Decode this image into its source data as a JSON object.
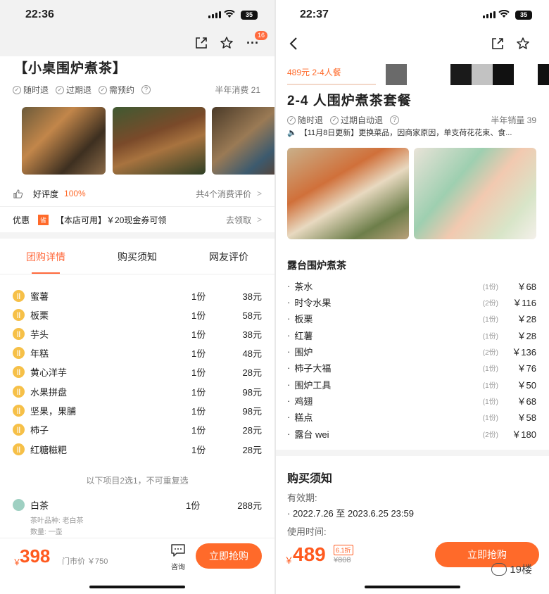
{
  "left": {
    "status": {
      "time": "22:36",
      "battery": "35"
    },
    "nav": {
      "badge": "16"
    },
    "shop_title": "【小桌围炉煮茶】",
    "tags": [
      "随时退",
      "过期退",
      "需预约"
    ],
    "half_year_consume": "半年消费 21",
    "rating": {
      "label": "好评度",
      "value": "100%",
      "reviews": "共4个消费评价"
    },
    "coupon": {
      "label": "优惠",
      "tag": "省",
      "text": "【本店可用】￥20现金券可领",
      "action": "去领取"
    },
    "tabs": [
      "团购详情",
      "购买须知",
      "网友评价"
    ],
    "items": [
      {
        "name": "蜜薯",
        "qty": "1份",
        "price": "38元"
      },
      {
        "name": "板栗",
        "qty": "1份",
        "price": "58元"
      },
      {
        "name": "芋头",
        "qty": "1份",
        "price": "38元"
      },
      {
        "name": "年糕",
        "qty": "1份",
        "price": "48元"
      },
      {
        "name": "黄心洋芋",
        "qty": "1份",
        "price": "28元"
      },
      {
        "name": "水果拼盘",
        "qty": "1份",
        "price": "98元"
      },
      {
        "name": "坚果，果脯",
        "qty": "1份",
        "price": "98元"
      },
      {
        "name": "柿子",
        "qty": "1份",
        "price": "28元"
      },
      {
        "name": "红糖糍粑",
        "qty": "1份",
        "price": "28元"
      }
    ],
    "choice_note": "以下项目2选1，不可重复选",
    "tea": {
      "name": "白茶",
      "qty": "1份",
      "price": "288元",
      "variety": "茶叶品种: 老白茶",
      "amount": "数量: 一壶"
    },
    "bottom": {
      "currency": "￥",
      "price": "398",
      "original": "门市价 ￥750",
      "consult": "咨询",
      "buy": "立即抢购"
    }
  },
  "right": {
    "status": {
      "time": "22:37",
      "battery": "35"
    },
    "package_tag": "489元 2-4人餐",
    "title": "2-4 人围炉煮茶套餐",
    "tags": [
      "随时退",
      "过期自动退"
    ],
    "half_year_sales": "半年销量 39",
    "notice": "【11月8日更新】更换菜品，因商家原因，单支荷花花束、食...",
    "section": "露台围炉煮茶",
    "items": [
      {
        "name": "茶水",
        "qty": "(1份)",
        "price": "￥68"
      },
      {
        "name": "时令水果",
        "qty": "(2份)",
        "price": "￥116"
      },
      {
        "name": "板栗",
        "qty": "(1份)",
        "price": "￥28"
      },
      {
        "name": "红薯",
        "qty": "(1份)",
        "price": "￥28"
      },
      {
        "name": "围炉",
        "qty": "(2份)",
        "price": "￥136"
      },
      {
        "name": "柿子大福",
        "qty": "(1份)",
        "price": "￥76"
      },
      {
        "name": "围炉工具",
        "qty": "(1份)",
        "price": "￥50"
      },
      {
        "name": "鸡翅",
        "qty": "(1份)",
        "price": "￥68"
      },
      {
        "name": "糕点",
        "qty": "(1份)",
        "price": "￥58"
      },
      {
        "name": "露台 wei",
        "qty": "(2份)",
        "price": "￥180"
      }
    ],
    "purchase_notes": {
      "title": "购买须知",
      "validity_label": "有效期:",
      "validity": "2022.7.26 至 2023.6.25 23:59",
      "usage_label": "使用时间:"
    },
    "bottom": {
      "currency": "￥",
      "price": "489",
      "discount": "6.1折",
      "original": "¥808",
      "buy": "立即抢购"
    },
    "watermark": "19楼"
  }
}
